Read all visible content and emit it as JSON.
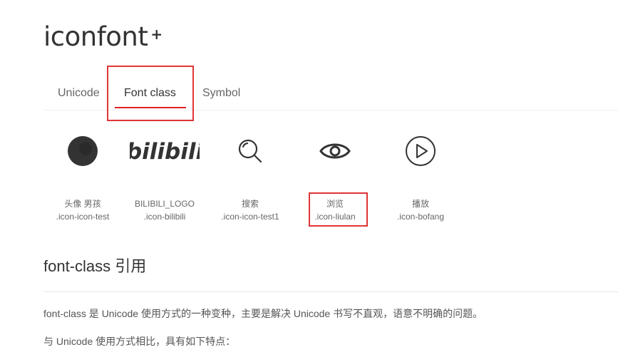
{
  "logo": {
    "text": "iconfont",
    "plus": "+"
  },
  "tabs": [
    {
      "label": "Unicode",
      "active": false
    },
    {
      "label": "Font class",
      "active": true
    },
    {
      "label": "Symbol",
      "active": false
    }
  ],
  "icons": [
    {
      "name": "头像 男孩",
      "class": ".icon-icon-test",
      "icon": "avatar-boy-icon"
    },
    {
      "name": "BILIBILI_LOGO",
      "class": ".icon-bilibili",
      "icon": "bilibili-logo-icon",
      "logo_text": "bilibili"
    },
    {
      "name": "搜索",
      "class": ".icon-icon-test1",
      "icon": "search-icon"
    },
    {
      "name": "浏览",
      "class": ".icon-liulan",
      "icon": "eye-icon"
    },
    {
      "name": "播放",
      "class": ".icon-bofang",
      "icon": "play-icon"
    }
  ],
  "section": {
    "title": "font-class 引用",
    "paragraphs": [
      "font-class 是 Unicode 使用方式的一种变种，主要是解决 Unicode 书写不直观，语意不明确的问题。",
      "与 Unicode 使用方式相比，具有如下特点："
    ]
  },
  "colors": {
    "accent": "#e02020",
    "highlight_box": "#e03434",
    "text": "#333333",
    "muted": "#666666"
  }
}
